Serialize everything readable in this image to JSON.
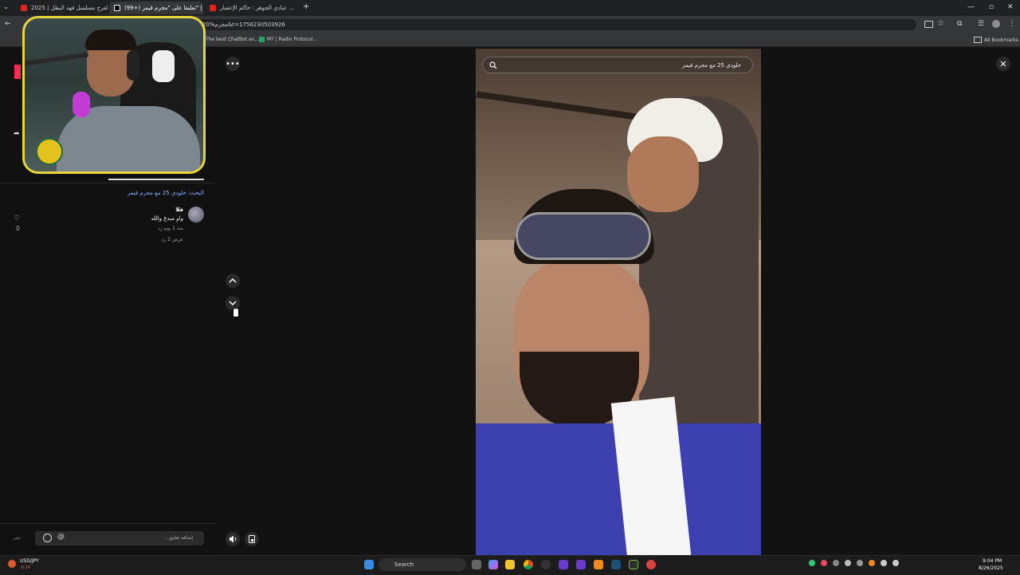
{
  "browser": {
    "tabs": [
      {
        "label": "الفرح مسلسل فهد البطل | 2025",
        "icon": "youtube-icon"
      },
      {
        "label": "(99+) تعليقا على \"مجرم قيمز\" | tiktok",
        "icon": "tiktok-icon"
      },
      {
        "label": "عبادي الجوهر : حاكم الإعصار ... ",
        "icon": "youtube-icon"
      }
    ],
    "new_tab": "+",
    "url": "20%مجرم&t=1756230503926",
    "bookmarks": [
      {
        "label": "The best ChatBot an..."
      },
      {
        "label": "MT | Radio Protocol..."
      }
    ],
    "all_bookmarks": "All Bookmarks"
  },
  "left_panel": {
    "search_heading": "البحث: خلودي 25 مع مجرم قيمز",
    "comment": {
      "author": "فلا",
      "text": "واو مبدع والله",
      "meta": "منذ 1 يوم   رد",
      "view_replies": "عرض 2 رد",
      "likes": "0"
    },
    "comment_placeholder": "إضافة تعليق...",
    "send_label": "نشر"
  },
  "video": {
    "search_value": "خلودي 25 مع مجرم قيمز"
  },
  "taskbar": {
    "ticker_symbol": "USD/JPY",
    "ticker_change": "-0.24",
    "search_label": "Search",
    "time": "9:04 PM",
    "date": "8/26/2025"
  },
  "colors": {
    "accent_link": "#8ab4ff",
    "webcam_border": "#e5d43b",
    "video_purple": "#3b3fb0"
  }
}
